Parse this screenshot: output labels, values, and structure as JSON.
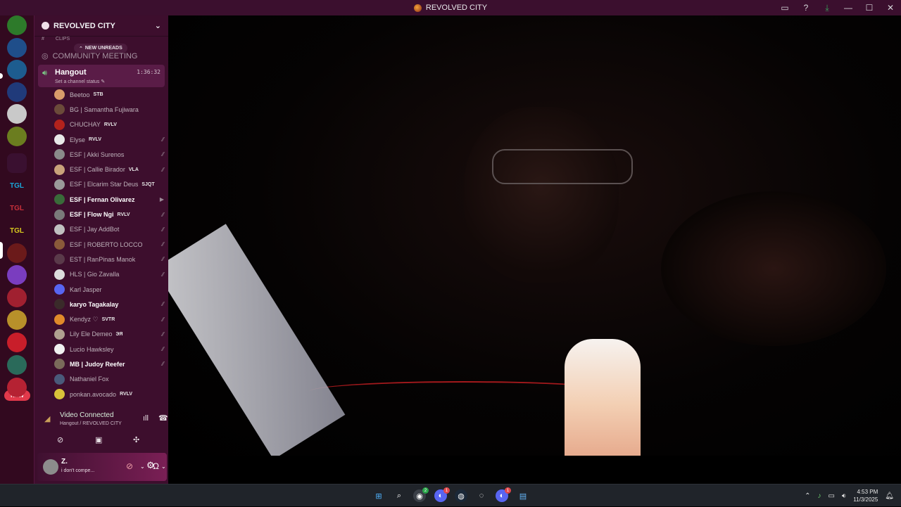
{
  "window": {
    "title": "REVOLVED CITY"
  },
  "server_sidebar": {
    "new_badge": "NEW",
    "servers": [
      {
        "color": "#2d7a2a",
        "label": ""
      },
      {
        "color": "#1f4e8a",
        "label": ""
      },
      {
        "color": "#1d5c8f",
        "label": ""
      },
      {
        "color": "#203a7a",
        "label": ""
      },
      {
        "color": "#c9c9c9",
        "label": ""
      },
      {
        "color": "#6b7d1f",
        "label": ""
      },
      {
        "color": "#5865f2",
        "label": ""
      },
      {
        "color": "#1aa6d9",
        "label": "TGL"
      },
      {
        "color": "#c8303a",
        "label": "TGL"
      },
      {
        "color": "#d6c81f",
        "label": "TGL"
      },
      {
        "color": "#6b1a1a",
        "label": ""
      },
      {
        "color": "#7a3dbf",
        "label": ""
      },
      {
        "color": "#a02030",
        "label": ""
      },
      {
        "color": "#b8902a",
        "label": ""
      },
      {
        "color": "#c81e2a",
        "label": ""
      },
      {
        "color": "#2a6a5a",
        "label": ""
      },
      {
        "color": "#b52233",
        "label": ""
      }
    ]
  },
  "channel_panel": {
    "guild_name": "REVOLVED CITY",
    "clips_label": "CLIPS",
    "new_unreads": "NEW UNREADS",
    "community_meeting": "COMMUNITY MEETING",
    "voice_channel": {
      "name": "Hangout",
      "timer": "1:36:32",
      "status_prompt": "Set a channel status"
    },
    "members": [
      {
        "name": "Beetoo",
        "tag": "STB",
        "bold": false,
        "avatar": "#d89c6a",
        "status": ""
      },
      {
        "name": "BG | Samantha Fujiwara",
        "tag": "",
        "bold": false,
        "avatar": "#6b4a3a",
        "status": ""
      },
      {
        "name": "CHUCHAY",
        "tag": "RVLV",
        "bold": false,
        "avatar": "#b3221c",
        "status": ""
      },
      {
        "name": "Elyse",
        "tag": "RVLV",
        "bold": false,
        "avatar": "#e8e8e8",
        "status": "deaf"
      },
      {
        "name": "ESF | Akki Surenos",
        "tag": "",
        "bold": false,
        "avatar": "#8a8a8a",
        "status": "deaf"
      },
      {
        "name": "ESF | Callie Birador",
        "tag": "VLA",
        "bold": false,
        "avatar": "#c9a27a",
        "status": "deaf"
      },
      {
        "name": "ESF | Elcarim Star Deus",
        "tag": "SJQT",
        "bold": false,
        "avatar": "#9a9a9a",
        "status": ""
      },
      {
        "name": "ESF | Fernan Olivarez",
        "tag": "",
        "bold": true,
        "avatar": "#3a6b3a",
        "status": "video"
      },
      {
        "name": "ESF | Flow Ngi",
        "tag": "RVLV",
        "bold": true,
        "avatar": "#7a7a7a",
        "status": "deaf"
      },
      {
        "name": "ESF | Jay AddBot",
        "tag": "",
        "bold": false,
        "avatar": "#c0c0c0",
        "status": "deaf"
      },
      {
        "name": "ESF | ROBERTO LOCCO",
        "tag": "",
        "bold": false,
        "avatar": "#8a5a3a",
        "status": "deaf"
      },
      {
        "name": "EST | RanPinas Manok",
        "tag": "",
        "bold": false,
        "avatar": "#5a3a4a",
        "status": "deaf"
      },
      {
        "name": "HLS | Gio Zavalla",
        "tag": "",
        "bold": false,
        "avatar": "#dcdcdc",
        "status": "deaf"
      },
      {
        "name": "Karl Jasper",
        "tag": "",
        "bold": false,
        "avatar": "#5865f2",
        "status": ""
      },
      {
        "name": "karyo Tagakalay",
        "tag": "",
        "bold": true,
        "avatar": "#3a2a2a",
        "status": "deaf"
      },
      {
        "name": "Kendyz ♡",
        "tag": "SVTR",
        "bold": false,
        "avatar": "#e08a2a",
        "status": "deaf"
      },
      {
        "name": "Lily Ele Demeo",
        "tag": "ЭЯ",
        "bold": false,
        "avatar": "#b0a090",
        "status": "deaf"
      },
      {
        "name": "Lucio Hawksley",
        "tag": "",
        "bold": false,
        "avatar": "#f0f0f0",
        "status": "deaf"
      },
      {
        "name": "MB | Judoy Reefer",
        "tag": "",
        "bold": true,
        "avatar": "#7a6a5a",
        "status": "deaf"
      },
      {
        "name": "Nathaniel Fox",
        "tag": "",
        "bold": false,
        "avatar": "#4a5a7a",
        "status": ""
      },
      {
        "name": "ponkan.avocado",
        "tag": "RVLV",
        "bold": false,
        "avatar": "#d9c23a",
        "status": ""
      }
    ],
    "voice_connection": {
      "title": "Video Connected",
      "subtitle": "Hangout / REVOLVED CITY"
    },
    "user": {
      "name": "Z.",
      "status": "i don't compe..."
    }
  },
  "taskbar": {
    "clock_time": "4:53 PM",
    "clock_date": "11/3/2025",
    "badges": {
      "chrome": "2",
      "discord1": "1",
      "discord2": "1"
    }
  }
}
